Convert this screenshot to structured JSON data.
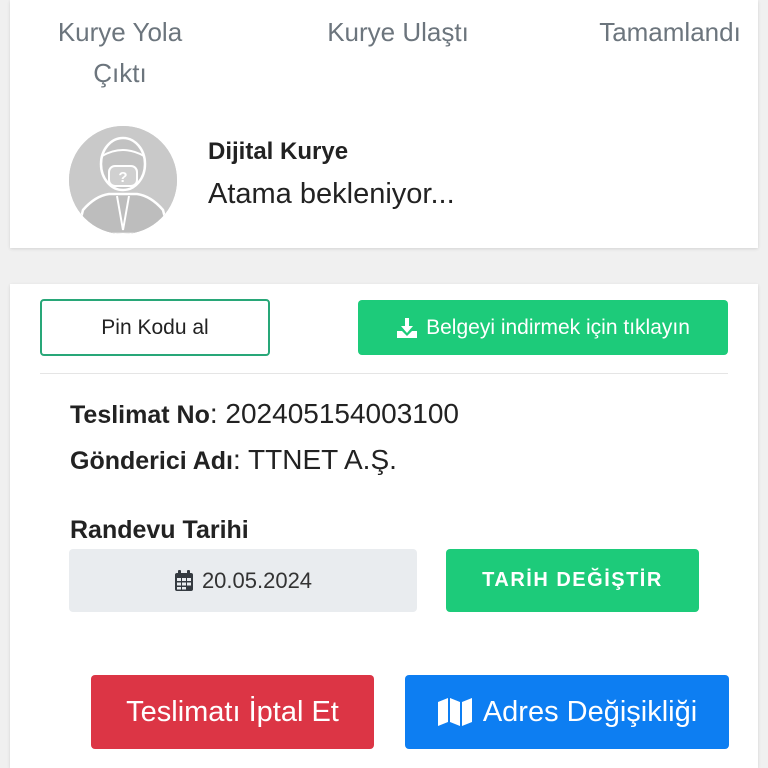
{
  "steps": [
    "Kurye Yola Çıktı",
    "Kurye Ulaştı",
    "Tamamlandı"
  ],
  "courier": {
    "name": "Dijital Kurye",
    "status": "Atama bekleniyor..."
  },
  "actions": {
    "pin_label": "Pin Kodu al",
    "download_label": "Belgeyi indirmek için tıklayın",
    "download_icon": "download-icon",
    "download_color": "#1dcb7a"
  },
  "details": {
    "teslimat_label": "Teslimat No",
    "teslimat_value": "202405154003100",
    "gonderici_label": "Gönderici Adı",
    "gonderici_value": "TTNET A.Ş."
  },
  "appointment": {
    "label": "Randevu Tarihi",
    "date": "20.05.2024",
    "date_icon": "calendar-icon",
    "change_label": "TARİH DEĞİŞTİR"
  },
  "footer": {
    "cancel_label": "Teslimatı İptal Et",
    "cancel_color": "#dc3545",
    "address_label": "Adres Değişikliği",
    "address_icon": "map-icon",
    "address_color": "#0d7ef2"
  }
}
